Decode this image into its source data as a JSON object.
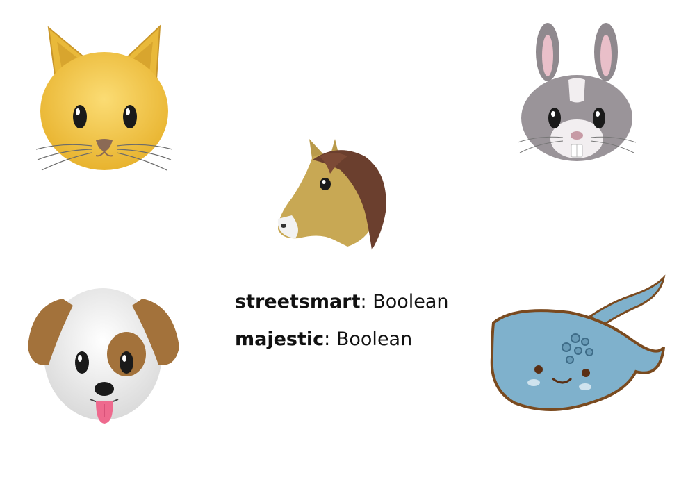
{
  "animals": [
    {
      "id": "cat",
      "icon": "cat-face-icon"
    },
    {
      "id": "rabbit",
      "icon": "rabbit-face-icon"
    },
    {
      "id": "horse",
      "icon": "horse-face-icon"
    },
    {
      "id": "dog",
      "icon": "dog-face-icon"
    },
    {
      "id": "stingray",
      "icon": "stingray-icon"
    }
  ],
  "properties": [
    {
      "name": "streetsmart",
      "separator": ":",
      "type": "Boolean"
    },
    {
      "name": "majestic",
      "separator": ":",
      "type": "Boolean"
    }
  ],
  "colors": {
    "cat": "#F3C94A",
    "rabbit": "#9A9499",
    "horse": "#B99A4A",
    "horse_mane": "#6B3F2E",
    "dog_ears": "#A3723B",
    "stingray": "#7FB1CC",
    "stingray_outline": "#7A4A1F",
    "text": "#111111"
  }
}
